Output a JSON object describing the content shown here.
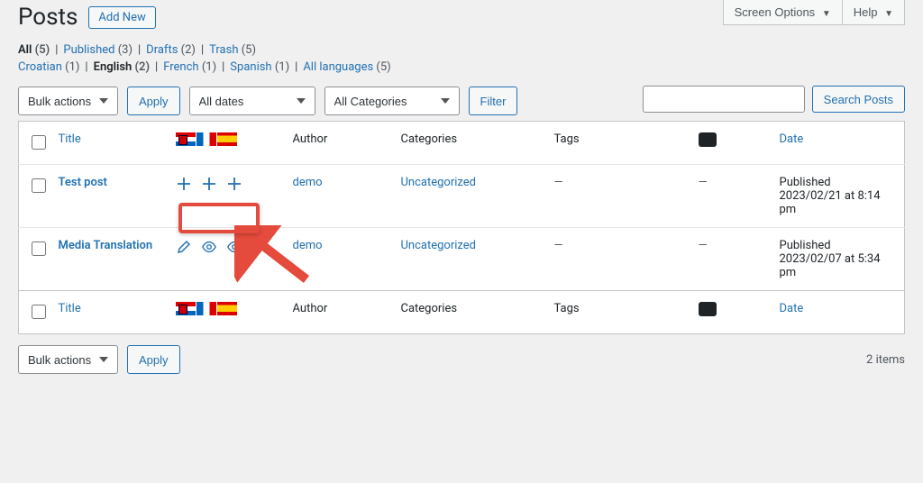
{
  "top": {
    "screen_options": "Screen Options",
    "help": "Help"
  },
  "heading": {
    "title": "Posts",
    "add_new": "Add New"
  },
  "status_filters": [
    {
      "label": "All",
      "count": 5,
      "active": true
    },
    {
      "label": "Published",
      "count": 3,
      "active": false
    },
    {
      "label": "Drafts",
      "count": 2,
      "active": false
    },
    {
      "label": "Trash",
      "count": 5,
      "active": false
    }
  ],
  "lang_filters": [
    {
      "label": "Croatian",
      "count": 1,
      "active": false
    },
    {
      "label": "English",
      "count": 2,
      "active": true
    },
    {
      "label": "French",
      "count": 1,
      "active": false
    },
    {
      "label": "Spanish",
      "count": 1,
      "active": false
    },
    {
      "label": "All languages",
      "count": 5,
      "active": false
    }
  ],
  "search": {
    "placeholder": "",
    "button": "Search Posts"
  },
  "bulk": {
    "label": "Bulk actions",
    "apply": "Apply"
  },
  "date_filter": "All dates",
  "cat_filter": "All Categories",
  "filter_button": "Filter",
  "items_count": "2 items",
  "columns": {
    "title": "Title",
    "author": "Author",
    "categories": "Categories",
    "tags": "Tags",
    "date": "Date"
  },
  "flags": [
    "hr",
    "fr",
    "es"
  ],
  "rows": [
    {
      "title": "Test post",
      "author": "demo",
      "categories": "Uncategorized",
      "tags": "—",
      "comments": "—",
      "date_status": "Published",
      "date_line2": "2023/02/21 at 8:14 pm",
      "trans_mode": "add"
    },
    {
      "title": "Media Translation",
      "author": "demo",
      "categories": "Uncategorized",
      "tags": "—",
      "comments": "—",
      "date_status": "Published",
      "date_line2": "2023/02/07 at 5:34 pm",
      "trans_mode": "view"
    }
  ],
  "annotation": {
    "highlight_target": "row-0-trans"
  }
}
